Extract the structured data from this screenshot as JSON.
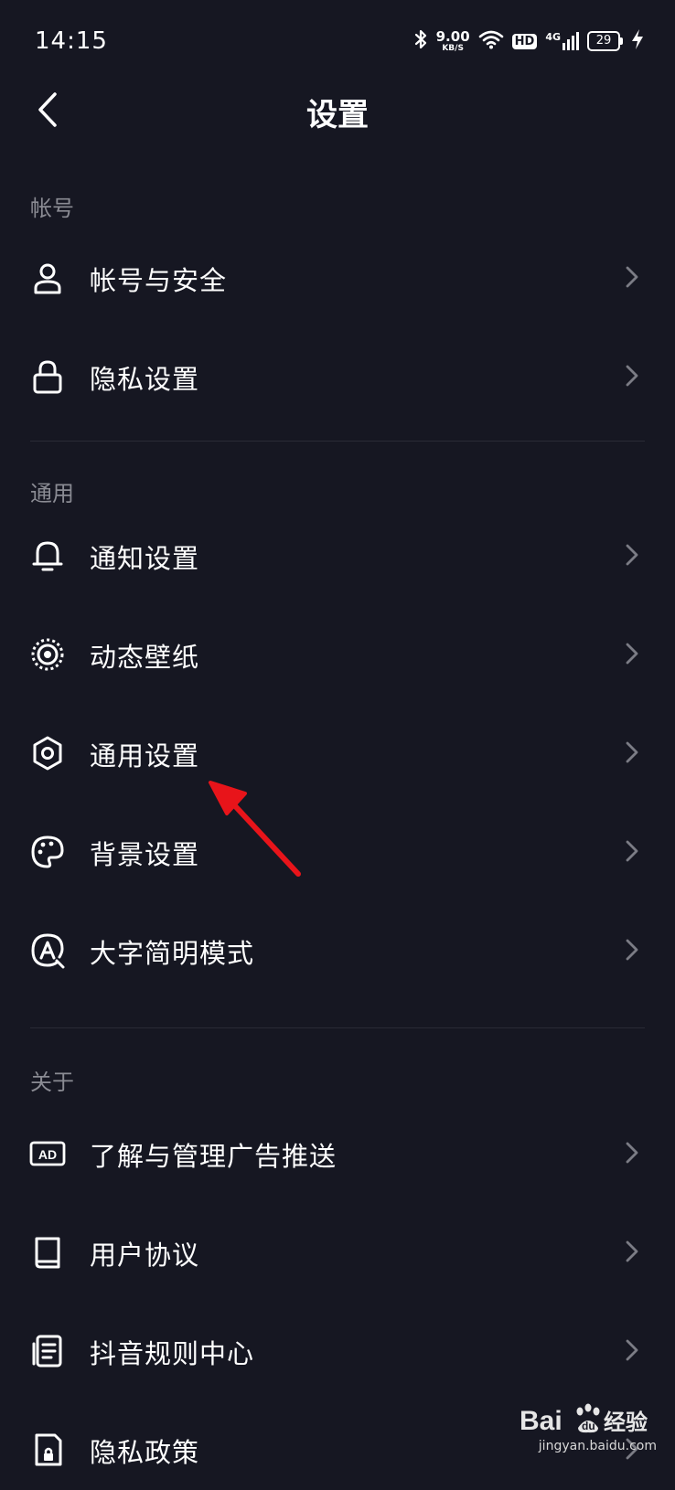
{
  "status_bar": {
    "time": "14:15",
    "speed_value": "9.00",
    "speed_unit": "KB/S",
    "hd": "HD",
    "network": "4G",
    "battery": "29"
  },
  "nav": {
    "title": "设置"
  },
  "sections": {
    "account": {
      "header": "帐号",
      "items": [
        {
          "label": "帐号与安全",
          "icon": "user-icon"
        },
        {
          "label": "隐私设置",
          "icon": "lock-icon"
        }
      ]
    },
    "general": {
      "header": "通用",
      "items": [
        {
          "label": "通知设置",
          "icon": "bell-icon"
        },
        {
          "label": "动态壁纸",
          "icon": "wallpaper-icon"
        },
        {
          "label": "通用设置",
          "icon": "gear-icon"
        },
        {
          "label": "背景设置",
          "icon": "palette-icon"
        },
        {
          "label": "大字简明模式",
          "icon": "large-font-icon"
        }
      ]
    },
    "about": {
      "header": "关于",
      "items": [
        {
          "label": "了解与管理广告推送",
          "icon": "ad-icon"
        },
        {
          "label": "用户协议",
          "icon": "book-icon"
        },
        {
          "label": "抖音规则中心",
          "icon": "rules-icon"
        },
        {
          "label": "隐私政策",
          "icon": "privacy-policy-icon"
        }
      ]
    }
  },
  "watermark": {
    "logo_text": "Bai",
    "logo_text2": "du",
    "logo_cn": "经验",
    "url": "jingyan.baidu.com"
  },
  "colors": {
    "background": "#161722",
    "section_header": "#8a8b93",
    "divider": "#2a2b36",
    "annotation": "#e8141a"
  }
}
